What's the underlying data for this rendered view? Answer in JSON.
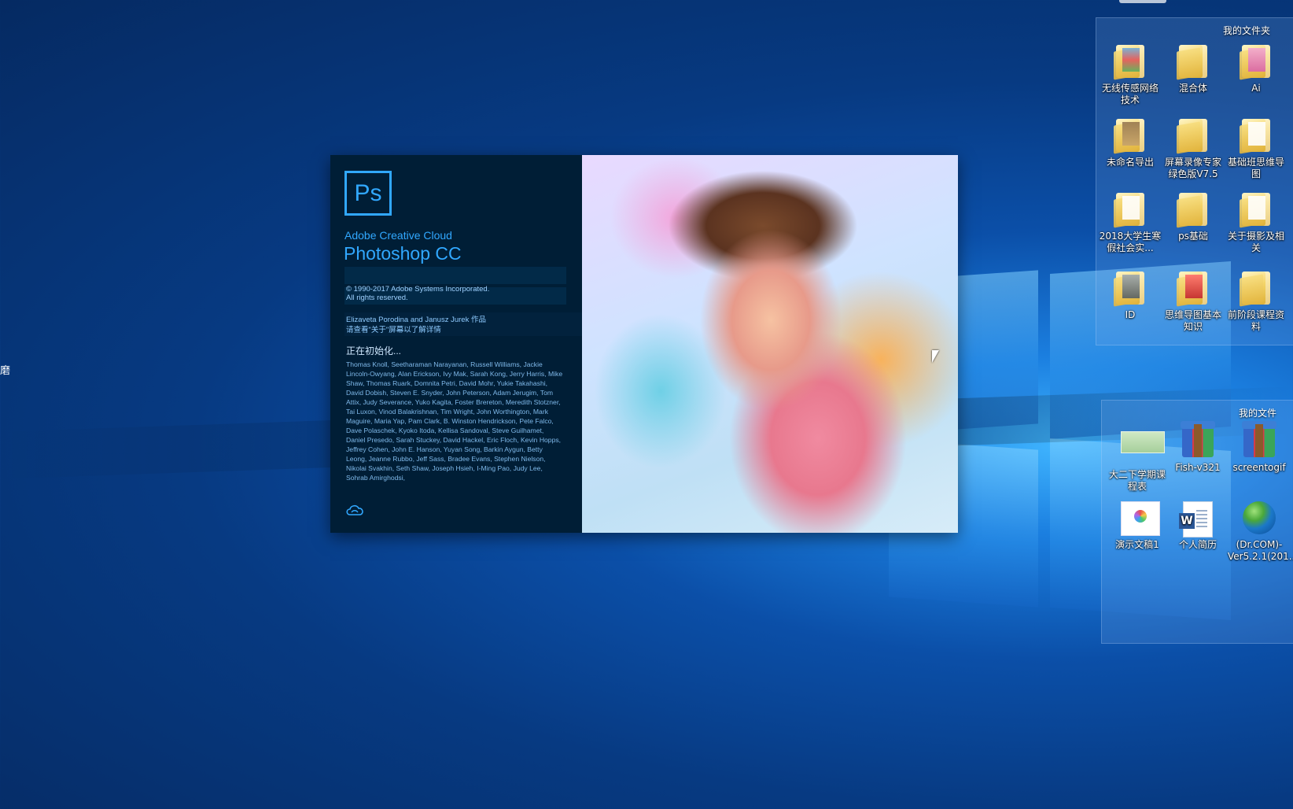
{
  "desktop": {
    "edge_text": "磨"
  },
  "fence_folders": {
    "title": "我的文件夹",
    "items": [
      {
        "label": "无线传感网络技术",
        "icon": "folder-icon"
      },
      {
        "label": "混合体",
        "icon": "folder-icon"
      },
      {
        "label": "Ai",
        "icon": "folder-icon"
      },
      {
        "label": "未命名导出",
        "icon": "folder-icon"
      },
      {
        "label": "屏幕录像专家绿色版V7.5",
        "icon": "folder-icon"
      },
      {
        "label": "基础班思维导图",
        "icon": "folder-icon"
      },
      {
        "label": "2018大学生寒假社会实...",
        "icon": "folder-icon"
      },
      {
        "label": "ps基础",
        "icon": "folder-icon"
      },
      {
        "label": "关于摄影及相关",
        "icon": "folder-icon"
      },
      {
        "label": "ID",
        "icon": "folder-icon"
      },
      {
        "label": "思维导图基本知识",
        "icon": "folder-icon"
      },
      {
        "label": "前阶段课程资料",
        "icon": "folder-icon"
      }
    ]
  },
  "fence_files": {
    "title": "我的文件",
    "items": [
      {
        "label": "大二下学期课程表",
        "icon": "image-thumbnail-icon"
      },
      {
        "label": "Fish-v321",
        "icon": "winrar-archive-icon"
      },
      {
        "label": "screentogif",
        "icon": "winrar-archive-icon"
      },
      {
        "label": "演示文稿1",
        "icon": "presentation-icon"
      },
      {
        "label": "个人简历",
        "icon": "word-document-icon"
      },
      {
        "label": "(Dr.COM)-Ver5.2.1(201...",
        "icon": "globe-icon"
      }
    ]
  },
  "splash": {
    "logo_text": "Ps",
    "brand": "Adobe Creative Cloud",
    "product": "Photoshop CC",
    "copyright_line1": "© 1990-2017 Adobe Systems Incorporated.",
    "copyright_line2": "All rights reserved.",
    "artwork_credit": "Elizaveta Porodina and Janusz Jurek 作品",
    "artwork_hint": "请查看\"关于\"屏幕以了解详情",
    "status": "正在初始化...",
    "contributors": "Thomas Knoll, Seetharaman Narayanan, Russell Williams, Jackie Lincoln-Owyang, Alan Erickson, Ivy Mak, Sarah Kong, Jerry Harris, Mike Shaw, Thomas Ruark, Domnita Petri, David Mohr, Yukie Takahashi, David Dobish, Steven E. Snyder, John Peterson, Adam Jerugim, Tom Attix, Judy Severance, Yuko Kagita, Foster Brereton, Meredith Stotzner, Tai Luxon, Vinod Balakrishnan, Tim Wright, John Worthington, Mark Maguire, Maria Yap, Pam Clark, B. Winston Hendrickson, Pete Falco, Dave Polaschek, Kyoko Itoda, Kellisa Sandoval, Steve Guilhamet, Daniel Presedo, Sarah Stuckey, David Hackel, Eric Floch, Kevin Hopps, Jeffrey Cohen, John E. Hanson, Yuyan Song, Barkin Aygun, Betty Leong, Jeanne Rubbo, Jeff Sass, Bradee Evans, Stephen Nielson, Nikolai Svakhin, Seth Shaw, Joseph Hsieh, I-Ming Pao, Judy Lee, Sohrab Amirghodsi,"
  },
  "colors": {
    "ps_blue": "#31a8ff",
    "ps_dark": "#001e36"
  }
}
